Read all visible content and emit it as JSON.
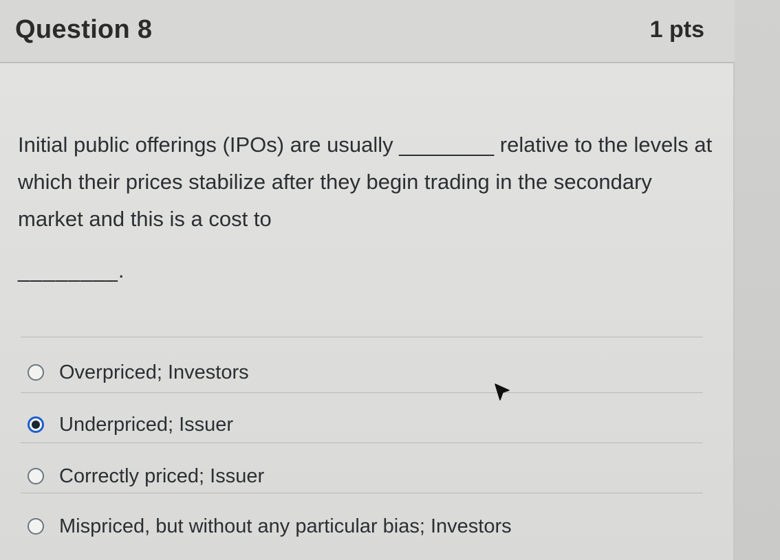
{
  "question": {
    "title": "Question 8",
    "points": "1 pts",
    "text": "Initial public offerings (IPOs) are usually ________ relative to the levels at which their prices stabilize after they begin trading in the secondary market and this is a cost to",
    "blank": "________."
  },
  "answers": [
    {
      "label": "Overpriced; Investors",
      "selected": false
    },
    {
      "label": "Underpriced; Issuer",
      "selected": true
    },
    {
      "label": "Correctly priced; Issuer",
      "selected": false
    },
    {
      "label": "Mispriced, but without any particular bias; Investors",
      "selected": false
    }
  ],
  "colors": {
    "selected_ring": "#1d5fd0",
    "text": "#2b2f33"
  },
  "icons": {
    "cursor": "mouse-pointer-icon"
  }
}
